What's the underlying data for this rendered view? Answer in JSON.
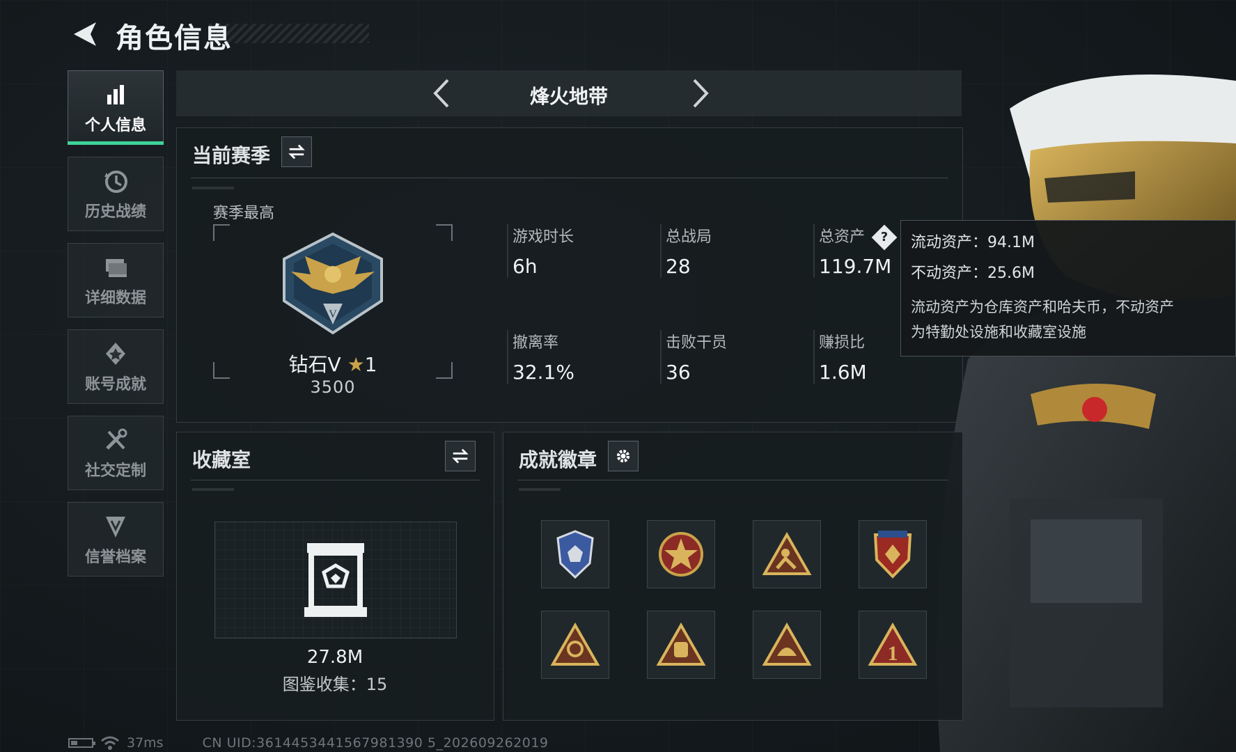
{
  "header": {
    "title": "角色信息"
  },
  "sidebar": {
    "items": [
      {
        "label": "个人信息",
        "icon": "bar-chart-icon",
        "active": true
      },
      {
        "label": "历史战绩",
        "icon": "history-icon",
        "active": false
      },
      {
        "label": "详细数据",
        "icon": "data-stack-icon",
        "active": false
      },
      {
        "label": "账号成就",
        "icon": "achievement-icon",
        "active": false
      },
      {
        "label": "社交定制",
        "icon": "tools-icon",
        "active": false
      },
      {
        "label": "信誉档案",
        "icon": "shield-emblem-icon",
        "active": false
      }
    ]
  },
  "mode": {
    "title": "烽火地带"
  },
  "season": {
    "title": "当前赛季",
    "best_label": "赛季最高",
    "rank_name": "钻石V",
    "rank_stars": "1",
    "rank_score": "3500",
    "stats": [
      {
        "label": "游戏时长",
        "value": "6h"
      },
      {
        "label": "总战局",
        "value": "28"
      },
      {
        "label": "总资产",
        "value": "119.7M"
      },
      {
        "label": "撤离率",
        "value": "32.1%"
      },
      {
        "label": "击败干员",
        "value": "36"
      },
      {
        "label": "赚损比",
        "value": "1.6M"
      }
    ]
  },
  "tooltip": {
    "liquid": "流动资产：94.1M",
    "fixed": "不动资产：25.6M",
    "note_line1": "流动资产为仓库资产和哈夫币，不动资产",
    "note_line2": "为特勤处设施和收藏室设施"
  },
  "collection": {
    "title": "收藏室",
    "value": "27.8M",
    "count": "图鉴收集：15"
  },
  "badges": {
    "title": "成就徽章",
    "items": [
      "police-badge-icon",
      "star-medal-icon",
      "triangle-runner-icon",
      "crest-shield-icon",
      "triangle-hands-icon",
      "triangle-backpack-icon",
      "triangle-helmet-icon",
      "triangle-number-one-icon"
    ]
  },
  "footer": {
    "ping": "37ms",
    "uid": "CN UID:3614453441567981390 5_202609262019"
  },
  "colors": {
    "accent": "#3fd49a",
    "gold": "#c9a24a",
    "panel": "#171d20"
  }
}
